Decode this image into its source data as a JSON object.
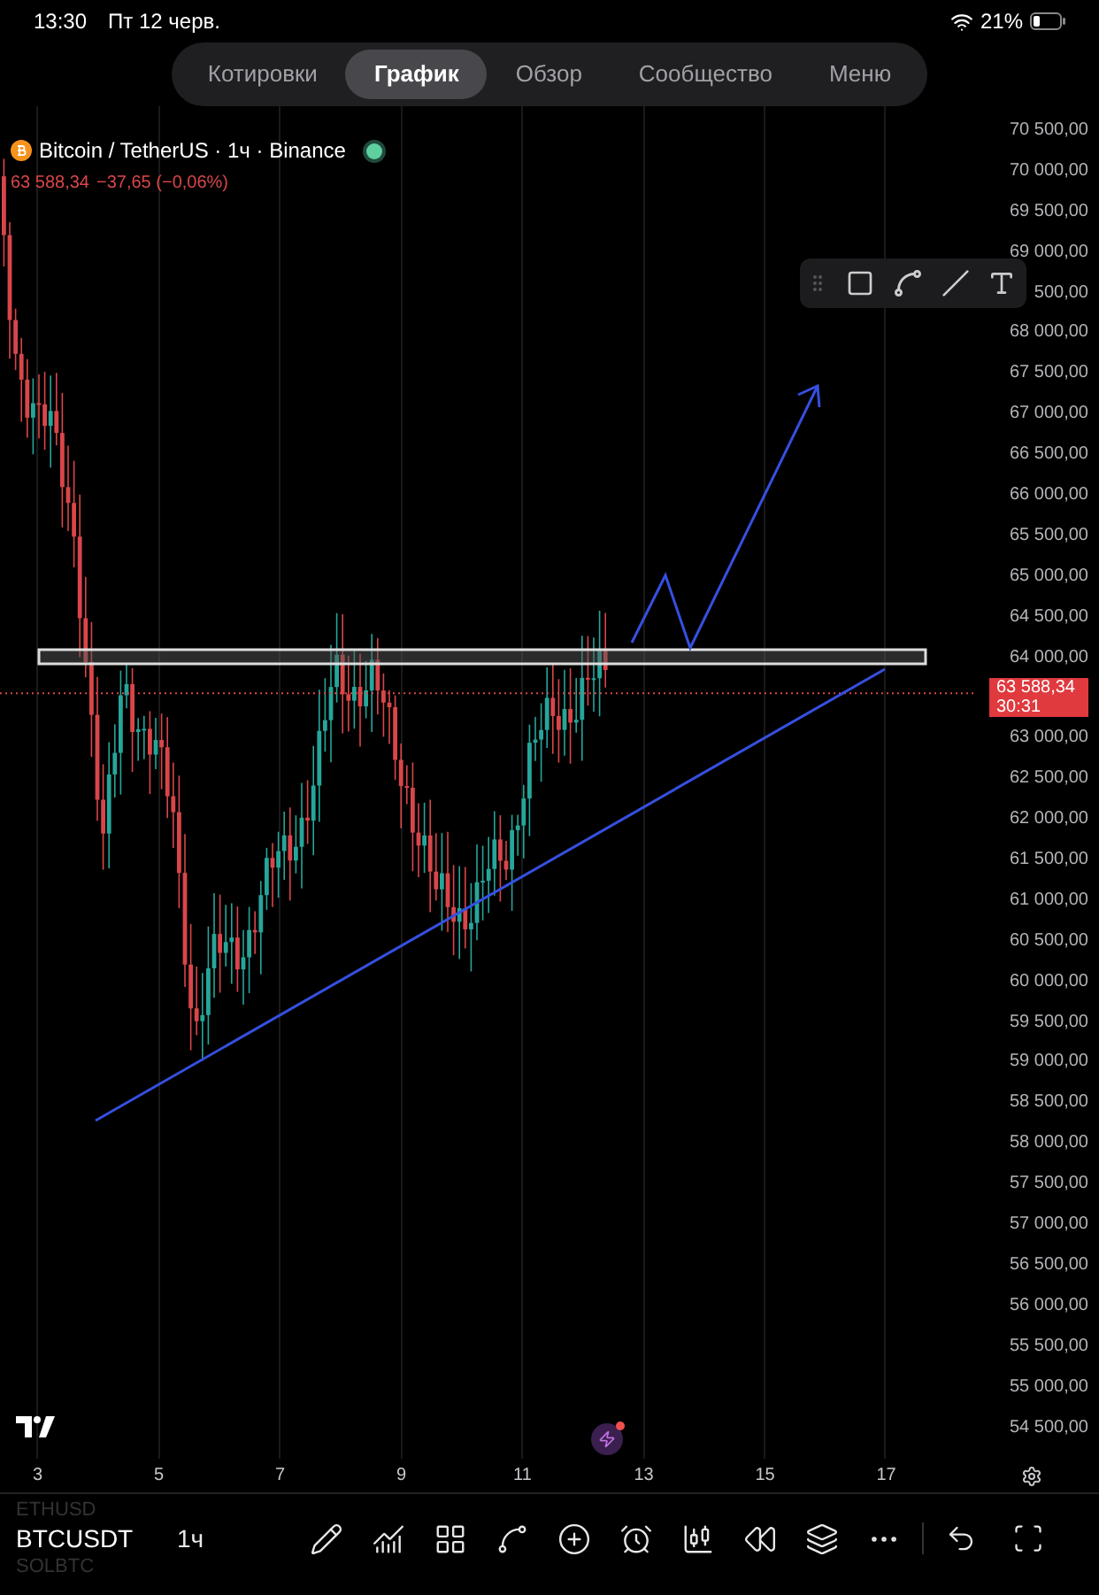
{
  "status_bar": {
    "time": "13:30",
    "date": "Пт 12 черв.",
    "battery": "21%"
  },
  "tabs": [
    {
      "label": "Котировки",
      "selected": false
    },
    {
      "label": "График",
      "selected": true
    },
    {
      "label": "Обзор",
      "selected": false
    },
    {
      "label": "Сообщество",
      "selected": false
    },
    {
      "label": "Меню",
      "selected": false
    }
  ],
  "symbol_header": {
    "title": "Bitcoin / TetherUS · 1ч · Binance",
    "price": "63 588,34",
    "change": "−37,65 (−0,06%)",
    "market_open": true
  },
  "y_axis": [
    "70 500,00",
    "70 000,00",
    "69 500,00",
    "69 000,00",
    "500,00",
    "68 000,00",
    "67 500,00",
    "67 000,00",
    "66 500,00",
    "66 000,00",
    "65 500,00",
    "65 000,00",
    "64 500,00",
    "64 000,00",
    "63 000,00",
    "62 500,00",
    "62 000,00",
    "61 500,00",
    "61 000,00",
    "60 500,00",
    "60 000,00",
    "59 500,00",
    "59 000,00",
    "58 500,00",
    "58 000,00",
    "57 500,00",
    "57 000,00",
    "56 500,00",
    "56 000,00",
    "55 500,00",
    "55 000,00",
    "54 500,00"
  ],
  "price_tag": {
    "price": "63 588,34",
    "countdown": "30:31"
  },
  "x_axis": [
    "3",
    "5",
    "7",
    "9",
    "11",
    "13",
    "15",
    "17"
  ],
  "symbols": [
    {
      "label": "ETHUSD",
      "selected": false
    },
    {
      "label": "BTCUSDT",
      "selected": true
    },
    {
      "label": "SOLBTC",
      "selected": false
    }
  ],
  "interval": "1ч"
}
